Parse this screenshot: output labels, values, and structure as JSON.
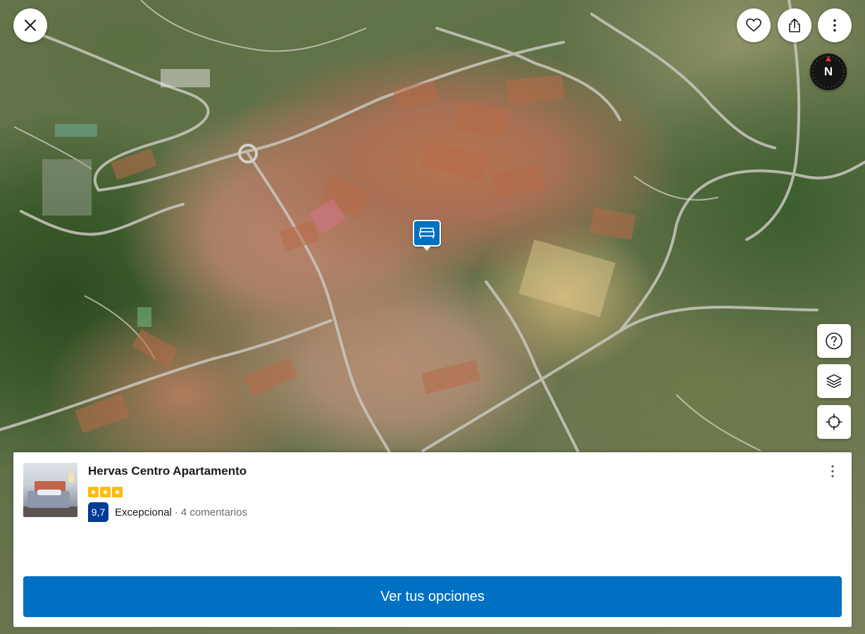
{
  "map": {
    "type": "satellite",
    "compass_label": "N"
  },
  "icons": {
    "close": "close-icon",
    "favorite": "heart-icon",
    "share": "share-icon",
    "more": "more-vertical-icon",
    "help": "help-circle-icon",
    "layers": "layers-icon",
    "locate": "crosshair-icon",
    "marker": "bed-icon"
  },
  "property": {
    "name": "Hervas Centro Apartamento",
    "star_count": 3,
    "score": "9,7",
    "rating_word": "Excepcional",
    "reviews": "4 comentarios"
  },
  "cta": {
    "label": "Ver tus opciones"
  },
  "colors": {
    "primary": "#0071c2",
    "score_bg": "#003b95",
    "stars": "#febb02"
  }
}
